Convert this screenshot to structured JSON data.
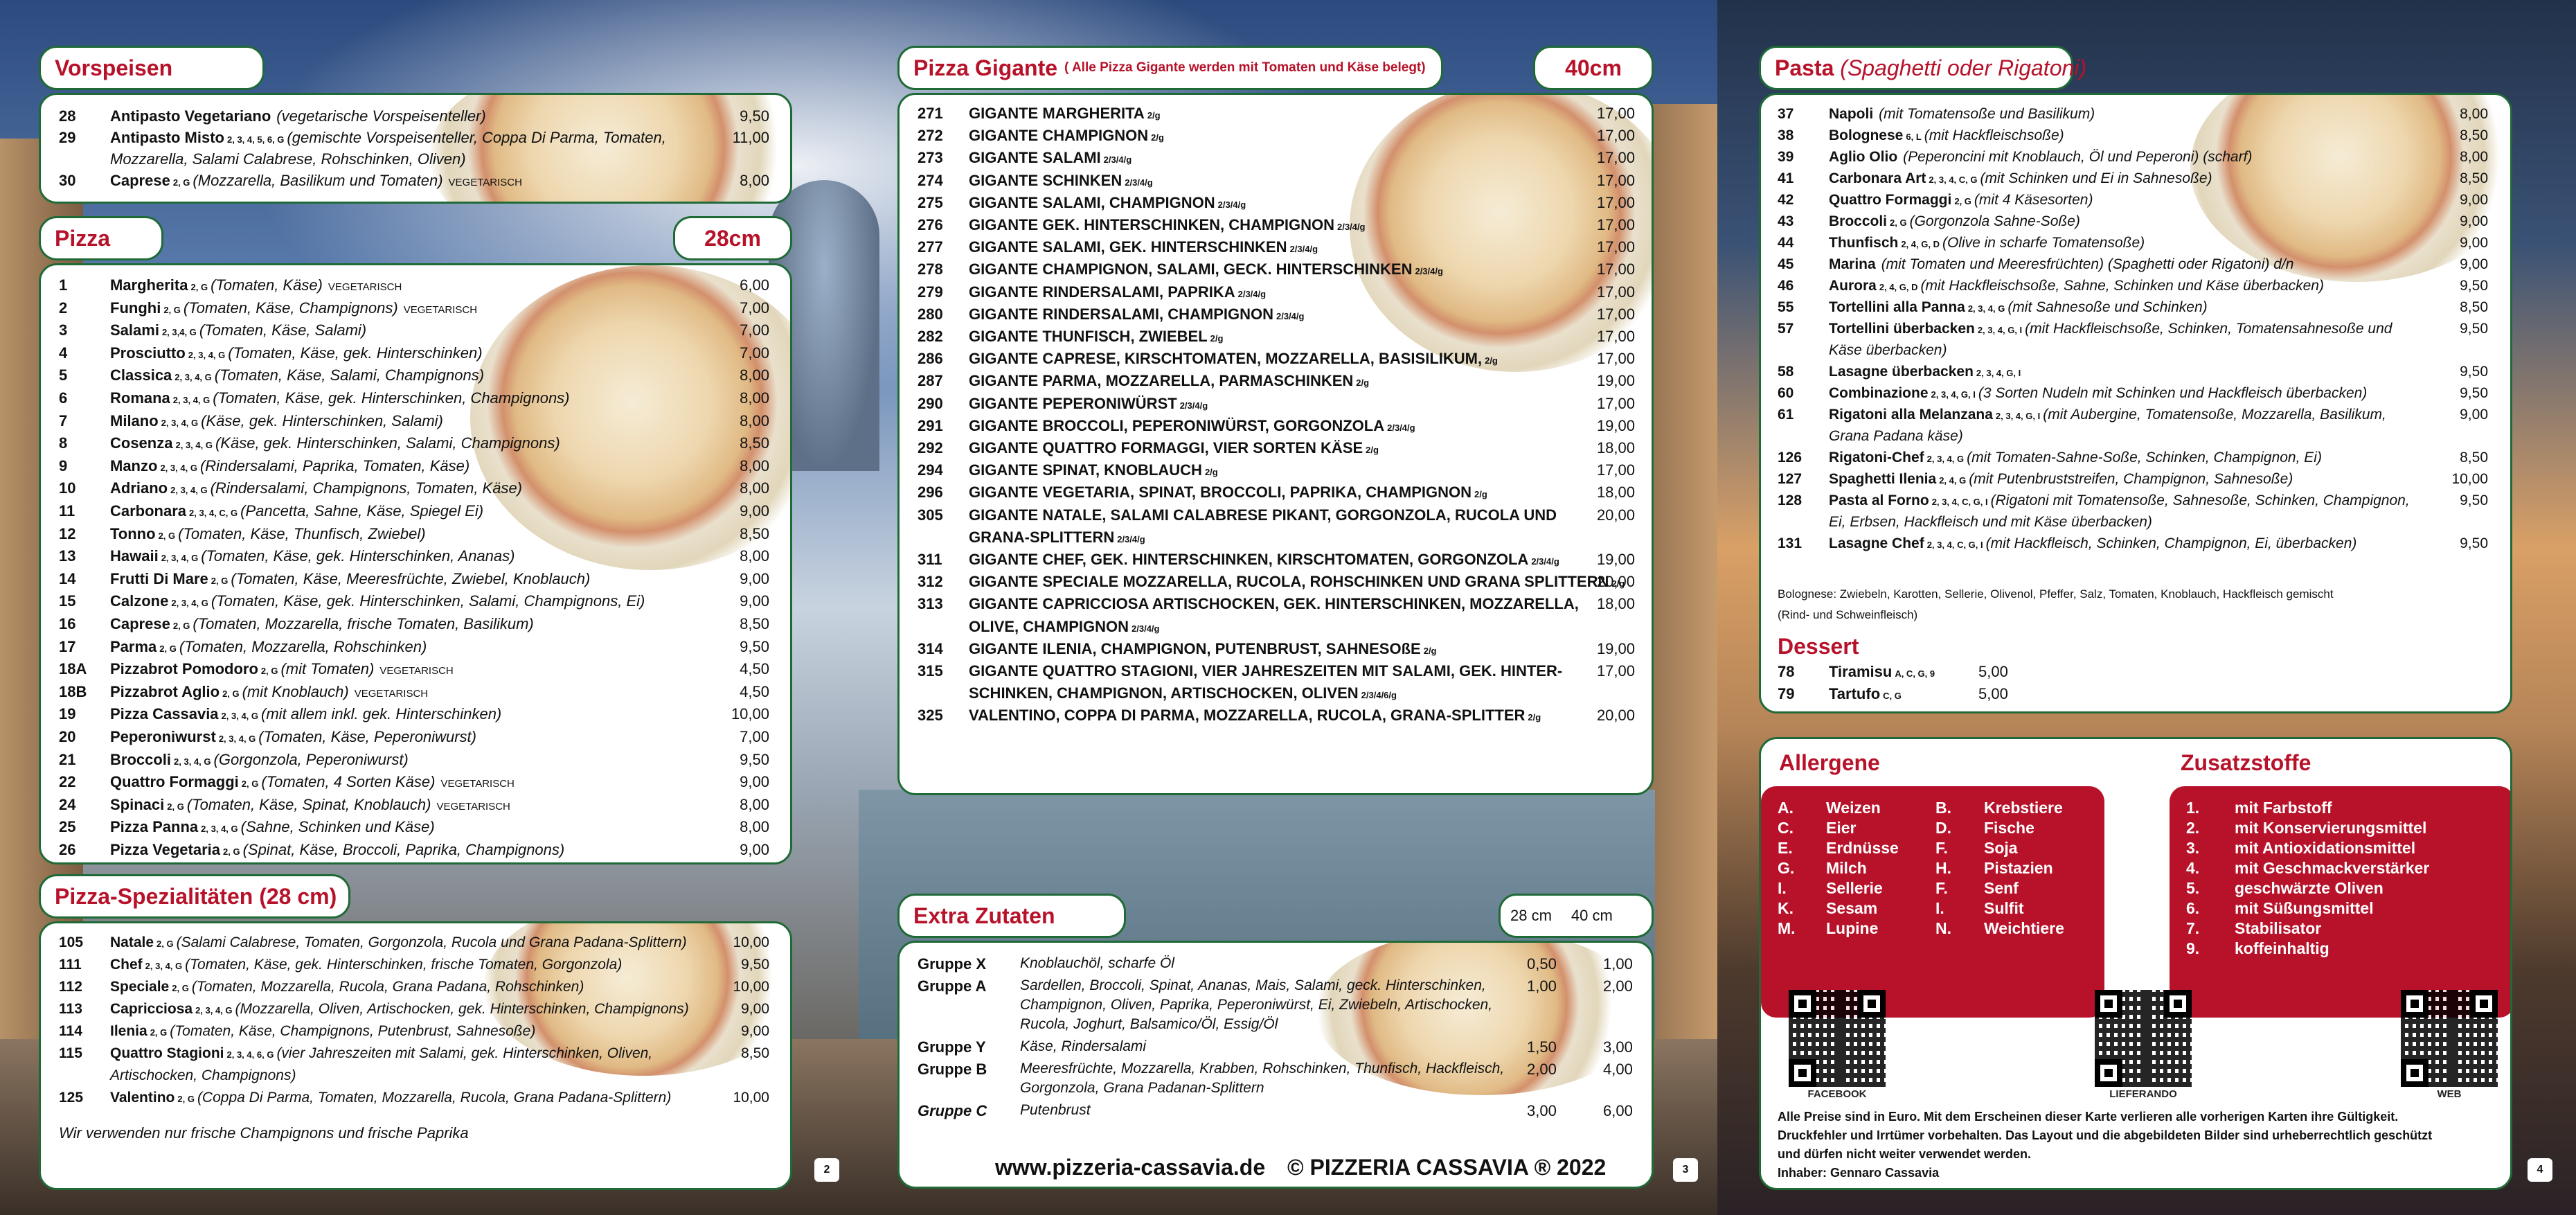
{
  "vorspeisen": {
    "title": "Vorspeisen",
    "items": [
      {
        "n": "28",
        "name": "Antipasto Vegetariano",
        "al": "",
        "desc": "(vegetarische Vorspeisenteller)",
        "price": "9,50"
      },
      {
        "n": "29",
        "name": "Antipasto Misto",
        "al": "2, 3, 4, 5, 6, G",
        "desc": "(gemischte Vorspeisenteller, Coppa Di Parma, Tomaten,",
        "price": "11,00",
        "cont": "Mozzarella, Salami Calabrese, Rohschinken, Oliven)"
      },
      {
        "n": "30",
        "name": "Caprese",
        "al": "2, G",
        "desc": "(Mozzarella, Basilikum und Tomaten)",
        "veg": "VEGETARISCH",
        "price": "8,00"
      }
    ]
  },
  "pizza": {
    "title": "Pizza",
    "size": "28cm",
    "items": [
      {
        "n": "1",
        "name": "Margherita",
        "al": "2, G",
        "desc": "(Tomaten, Käse)",
        "veg": "VEGETARISCH",
        "price": "6,00"
      },
      {
        "n": "2",
        "name": "Funghi",
        "al": "2, G",
        "desc": "(Tomaten, Käse, Champignons)",
        "veg": "VEGETARISCH",
        "price": "7,00"
      },
      {
        "n": "3",
        "name": "Salami",
        "al": "2, 3,4, G",
        "desc": "(Tomaten, Käse, Salami)",
        "price": "7,00"
      },
      {
        "n": "4",
        "name": "Prosciutto",
        "al": "2, 3, 4, G",
        "desc": "(Tomaten, Käse, gek. Hinterschinken)",
        "price": "7,00"
      },
      {
        "n": "5",
        "name": "Classica",
        "al": "2, 3, 4, G",
        "desc": "(Tomaten, Käse, Salami, Champignons)",
        "price": "8,00"
      },
      {
        "n": "6",
        "name": "Romana",
        "al": "2, 3, 4, G",
        "desc": "(Tomaten, Käse, gek. Hinterschinken, Champignons)",
        "price": "8,00"
      },
      {
        "n": "7",
        "name": "Milano",
        "al": "2, 3, 4, G",
        "desc": "(Käse, gek. Hinterschinken, Salami)",
        "price": "8,00"
      },
      {
        "n": "8",
        "name": "Cosenza",
        "al": "2, 3, 4, G",
        "desc": "(Käse, gek. Hinterschinken, Salami, Champignons)",
        "price": "8,50"
      },
      {
        "n": "9",
        "name": "Manzo",
        "al": "2, 3, 4, G",
        "desc": "(Rindersalami, Paprika, Tomaten, Käse)",
        "price": "8,00"
      },
      {
        "n": "10",
        "name": "Adriano",
        "al": "2, 3, 4, G",
        "desc": "(Rindersalami, Champignons, Tomaten, Käse)",
        "price": "8,00"
      },
      {
        "n": "11",
        "name": "Carbonara",
        "al": "2, 3, 4, C, G",
        "desc": "(Pancetta, Sahne, Käse, Spiegel Ei)",
        "price": "9,00"
      },
      {
        "n": "12",
        "name": "Tonno",
        "al": "2, G",
        "desc": "(Tomaten, Käse, Thunfisch, Zwiebel)",
        "price": "8,50"
      },
      {
        "n": "13",
        "name": "Hawaii",
        "al": "2, 3, 4, G",
        "desc": "(Tomaten, Käse, gek. Hinterschinken, Ananas)",
        "price": "8,00"
      },
      {
        "n": "14",
        "name": "Frutti Di Mare",
        "al": "2, G",
        "desc": "(Tomaten, Käse, Meeresfrüchte, Zwiebel, Knoblauch)",
        "price": "9,00"
      },
      {
        "n": "15",
        "name": "Calzone",
        "al": "2, 3, 4, G",
        "desc": "(Tomaten, Käse, gek. Hinterschinken, Salami, Champignons, Ei)",
        "price": "9,00"
      },
      {
        "n": "16",
        "name": "Caprese",
        "al": "2, G",
        "desc": "(Tomaten, Mozzarella, frische Tomaten, Basilikum)",
        "price": "8,50"
      },
      {
        "n": "17",
        "name": "Parma",
        "al": "2, G",
        "desc": "(Tomaten, Mozzarella, Rohschinken)",
        "price": "9,50"
      },
      {
        "n": "18A",
        "name": "Pizzabrot Pomodoro",
        "al": "2, G",
        "desc": "(mit Tomaten)",
        "veg": "VEGETARISCH",
        "price": "4,50"
      },
      {
        "n": "18B",
        "name": "Pizzabrot Aglio",
        "al": "2, G",
        "desc": "(mit Knoblauch)",
        "veg": "VEGETARISCH",
        "price": "4,50"
      },
      {
        "n": "19",
        "name": "Pizza Cassavia",
        "al": "2, 3, 4, G",
        "desc": "(mit allem inkl. gek. Hinterschinken)",
        "price": "10,00"
      },
      {
        "n": "20",
        "name": "Peperoniwurst",
        "al": "2, 3, 4, G",
        "desc": "(Tomaten, Käse, Peperoniwurst)",
        "price": "7,00"
      },
      {
        "n": "21",
        "name": "Broccoli",
        "al": "2, 3, 4, G",
        "desc": "(Gorgonzola, Peperoniwurst)",
        "price": "9,50"
      },
      {
        "n": "22",
        "name": "Quattro Formaggi",
        "al": "2, G",
        "desc": "(Tomaten, 4 Sorten Käse)",
        "veg": "VEGETARISCH",
        "price": "9,00"
      },
      {
        "n": "24",
        "name": "Spinaci",
        "al": "2, G",
        "desc": "(Tomaten, Käse, Spinat, Knoblauch)",
        "veg": "VEGETARISCH",
        "price": "8,00"
      },
      {
        "n": "25",
        "name": "Pizza Panna",
        "al": "2, 3, 4, G",
        "desc": "(Sahne, Schinken und Käse)",
        "price": "8,00"
      },
      {
        "n": "26",
        "name": "Pizza Vegetaria",
        "al": "2, G",
        "desc": "(Spinat, Käse, Broccoli, Paprika, Champignons)",
        "price": "9,00"
      }
    ]
  },
  "spezial": {
    "title": "Pizza-Spezialitäten (28 cm)",
    "items": [
      {
        "n": "105",
        "name": "Natale",
        "al": "2, G",
        "desc": "(Salami Calabrese, Tomaten, Gorgonzola, Rucola und Grana Padana-Splittern)",
        "price": "10,00"
      },
      {
        "n": "111",
        "name": "Chef",
        "al": "2, 3, 4, G",
        "desc": "(Tomaten, Käse, gek. Hinterschinken, frische Tomaten, Gorgonzola)",
        "price": "9,50"
      },
      {
        "n": "112",
        "name": "Speciale",
        "al": "2, G",
        "desc": "(Tomaten, Mozzarella, Rucola, Grana Padana, Rohschinken)",
        "price": "10,00"
      },
      {
        "n": "113",
        "name": "Capricciosa",
        "al": "2, 3, 4, G",
        "desc": "(Mozzarella, Oliven, Artischocken, gek. Hinterschinken, Champignons)",
        "price": "9,00"
      },
      {
        "n": "114",
        "name": "Ilenia",
        "al": "2, G",
        "desc": "(Tomaten, Käse, Champignons, Putenbrust, Sahnesoße)",
        "price": "9,00"
      },
      {
        "n": "115",
        "name": "Quattro Stagioni",
        "al": "2, 3, 4, 6, G",
        "desc": "(vier Jahreszeiten mit Salami, gek. Hinterschinken, Oliven,",
        "price": "8,50",
        "cont": "Artischocken, Champignons)"
      },
      {
        "n": "125",
        "name": "Valentino",
        "al": "2, G",
        "desc": "(Coppa Di Parma, Tomaten, Mozzarella, Rucola, Grana Padana-Splittern)",
        "price": "10,00"
      }
    ],
    "note": "Wir verwenden nur frische Champignons und frische Paprika"
  },
  "gigante": {
    "title": "Pizza Gigante",
    "sub": "( Alle Pizza Gigante werden mit Tomaten und Käse belegt)",
    "size": "40cm",
    "items": [
      {
        "n": "271",
        "name": "GIGANTE MARGHERITA",
        "al": "2/g",
        "price": "17,00"
      },
      {
        "n": "272",
        "name": "GIGANTE CHAMPIGNON",
        "al": "2/g",
        "price": "17,00"
      },
      {
        "n": "273",
        "name": "GIGANTE SALAMI",
        "al": "2/3/4/g",
        "price": "17,00"
      },
      {
        "n": "274",
        "name": "GIGANTE SCHINKEN",
        "al": "2/3/4/g",
        "price": "17,00"
      },
      {
        "n": "275",
        "name": "GIGANTE SALAMI, CHAMPIGNON",
        "al": "2/3/4/g",
        "price": "17,00"
      },
      {
        "n": "276",
        "name": "GIGANTE GEK. HINTERSCHINKEN, CHAMPIGNON",
        "al": "2/3/4/g",
        "price": "17,00"
      },
      {
        "n": "277",
        "name": "GIGANTE SALAMI, GEK. HINTERSCHINKEN",
        "al": "2/3/4/g",
        "price": "17,00"
      },
      {
        "n": "278",
        "name": "GIGANTE CHAMPIGNON, SALAMI, GECK. HINTERSCHINKEN",
        "al": "2/3/4/g",
        "price": "17,00"
      },
      {
        "n": "279",
        "name": "GIGANTE RINDERSALAMI, PAPRIKA",
        "al": "2/3/4/g",
        "price": "17,00"
      },
      {
        "n": "280",
        "name": "GIGANTE RINDERSALAMI, CHAMPIGNON",
        "al": "2/3/4/g",
        "price": "17,00"
      },
      {
        "n": "282",
        "name": "GIGANTE THUNFISCH, ZWIEBEL",
        "al": "2/g",
        "price": "17,00"
      },
      {
        "n": "286",
        "name": "GIGANTE CAPRESE, KIRSCHTOMATEN, MOZZARELLA, BASISILIKUM,",
        "al": "2/g",
        "price": "17,00"
      },
      {
        "n": "287",
        "name": "GIGANTE PARMA, MOZZARELLA, PARMASCHINKEN",
        "al": "2/g",
        "price": "19,00"
      },
      {
        "n": "290",
        "name": "GIGANTE PEPERONIWÜRST",
        "al": "2/3/4/g",
        "price": "17,00"
      },
      {
        "n": "291",
        "name": "GIGANTE BROCCOLI, PEPERONIWÜRST, GORGONZOLA",
        "al": "2/3/4/g",
        "price": "19,00"
      },
      {
        "n": "292",
        "name": "GIGANTE QUATTRO FORMAGGI, VIER SORTEN KÄSE",
        "al": "2/g",
        "price": "18,00"
      },
      {
        "n": "294",
        "name": "GIGANTE SPINAT, KNOBLAUCH",
        "al": "2/g",
        "price": "17,00"
      },
      {
        "n": "296",
        "name": "GIGANTE VEGETARIA, SPINAT, BROCCOLI, PAPRIKA, CHAMPIGNON",
        "al": "2/g",
        "price": "18,00"
      },
      {
        "n": "305",
        "name": "GIGANTE NATALE, SALAMI CALABRESE PIKANT, GORGONZOLA, RUCOLA UND",
        "al": "",
        "price": "20,00",
        "cont": "GRANA-SPLITTERN",
        "contal": "2/3/4/g"
      },
      {
        "n": "311",
        "name": "GIGANTE CHEF, GEK. HINTERSCHINKEN, KIRSCHTOMATEN, GORGONZOLA",
        "al": "2/3/4/g",
        "price": "19,00"
      },
      {
        "n": "312",
        "name": "GIGANTE SPECIALE MOZZARELLA, RUCOLA, ROHSCHINKEN UND GRANA SPLITTERN",
        "al": "2/g",
        "price": "20,00"
      },
      {
        "n": "313",
        "name": "GIGANTE CAPRICCIOSA ARTISCHOCKEN, GEK. HINTERSCHINKEN, MOZZARELLA,",
        "al": "",
        "price": "18,00",
        "cont": "OLIVE, CHAMPIGNON",
        "contal": "2/3/4/g"
      },
      {
        "n": "314",
        "name": "GIGANTE ILENIA, CHAMPIGNON, PUTENBRUST, SAHNESOßE",
        "al": "2/g",
        "price": "19,00"
      },
      {
        "n": "315",
        "name": "GIGANTE QUATTRO STAGIONI, VIER JAHRESZEITEN MIT SALAMI, GEK. HINTER-",
        "al": "",
        "price": "17,00",
        "cont": "SCHINKEN, CHAMPIGNON, ARTISCHOCKEN, OLIVEN",
        "contal": "2/3/4/6/g"
      },
      {
        "n": "325",
        "name": "VALENTINO, COPPA DI PARMA, MOZZARELLA, RUCOLA, GRANA-SPLITTER",
        "al": "2/g",
        "price": "20,00"
      }
    ]
  },
  "extra": {
    "title": "Extra Zutaten",
    "c1": "28 cm",
    "c2": "40 cm",
    "groups": [
      {
        "g": "Gruppe X",
        "lines": [
          "Knoblauchöl, scharfe Öl"
        ],
        "p1": "0,50",
        "p2": "1,00"
      },
      {
        "g": "Gruppe A",
        "lines": [
          "Sardellen, Broccoli, Spinat, Ananas, Mais, Salami, geck. Hinterschinken,",
          "Champignon, Oliven, Paprika, Peperoniwürst, Ei, Zwiebeln, Artischocken,",
          "Rucola, Joghurt, Balsamico/Öl, Essig/Öl"
        ],
        "p1": "1,00",
        "p2": "2,00"
      },
      {
        "g": "Gruppe Y",
        "lines": [
          "Käse, Rindersalami"
        ],
        "p1": "1,50",
        "p2": "3,00"
      },
      {
        "g": "Gruppe B",
        "lines": [
          "Meeresfrüchte, Mozzarella, Krabben, Rohschinken, Thunfisch, Hackfleisch,",
          "Gorgonzola, Grana Padanan-Splittern"
        ],
        "p1": "2,00",
        "p2": "4,00"
      },
      {
        "g": "Gruppe C",
        "lines": [
          "Putenbrust"
        ],
        "p1": "3,00",
        "p2": "6,00",
        "italic": true
      }
    ]
  },
  "footer": {
    "web": "www.pizzeria-cassavia.de",
    "copy": "© PIZZERIA CASSAVIA ® 2022",
    "p2": "2",
    "p3": "3",
    "p4": "4"
  },
  "pasta": {
    "title": "Pasta",
    "sub": "(Spaghetti oder Rigatoni)",
    "items": [
      {
        "n": "37",
        "name": "Napoli",
        "al": "",
        "desc": "(mit Tomatensoße und Basilikum)",
        "price": "8,00"
      },
      {
        "n": "38",
        "name": "Bolognese",
        "al": "6, L",
        "desc": "(mit Hackfleischsoße)",
        "price": "8,50"
      },
      {
        "n": "39",
        "name": "Aglio Olio",
        "al": "",
        "desc": "(Peperoncini mit Knoblauch, Öl und Peperoni) (scharf)",
        "price": "8,00"
      },
      {
        "n": "41",
        "name": "Carbonara Art",
        "al": "2, 3, 4, C, G",
        "desc": "(mit Schinken und Ei in Sahnesoße)",
        "price": "8,50"
      },
      {
        "n": "42",
        "name": "Quattro Formaggi",
        "al": "2, G",
        "desc": "(mit 4 Käsesorten)",
        "price": "9,00"
      },
      {
        "n": "43",
        "name": "Broccoli",
        "al": "2, G",
        "desc": "(Gorgonzola Sahne-Soße)",
        "price": "9,00"
      },
      {
        "n": "44",
        "name": "Thunfisch",
        "al": "2, 4, G, D",
        "desc": "(Olive in scharfe Tomatensoße)",
        "price": "9,00"
      },
      {
        "n": "45",
        "name": "Marina",
        "al": "",
        "desc": "(mit Tomaten und Meeresfrüchten) (Spaghetti oder Rigatoni) d/n",
        "price": "9,00"
      },
      {
        "n": "46",
        "name": "Aurora",
        "al": "2, 4, G, D",
        "desc": "(mit Hackfleischsoße, Sahne, Schinken und Käse überbacken)",
        "price": "9,50"
      },
      {
        "n": "55",
        "name": " Tortellini alla Panna",
        "al": "2, 3, 4, G",
        "desc": "(mit Sahnesoße und Schinken)",
        "price": "8,50"
      },
      {
        "n": "57",
        "name": "Tortellini überbacken",
        "al": "2, 3, 4, G, I",
        "desc": "(mit Hackfleischsoße, Schinken, Tomatensahnesoße und",
        "price": "9,50",
        "cont": "Käse überbacken)"
      },
      {
        "n": "58",
        "name": "Lasagne überbacken",
        "al": "2, 3, 4, G, I",
        "desc": "",
        "price": "9,50"
      },
      {
        "n": "60",
        "name": "Combinazione",
        "al": "2, 3, 4, G, I",
        "desc": "(3 Sorten Nudeln mit Schinken und Hackfleisch überbacken)",
        "price": "9,50"
      },
      {
        "n": "61",
        "name": "Rigatoni alla Melanzana",
        "al": "2, 3, 4, G, I",
        "desc": "(mit Aubergine, Tomatensoße, Mozzarella, Basilikum,",
        "price": "9,00",
        "cont": "Grana Padana käse)"
      },
      {
        "n": "126",
        "name": "Rigatoni-Chef",
        "al": "2, 3, 4, G",
        "desc": "(mit Tomaten-Sahne-Soße, Schinken, Champignon, Ei)",
        "price": "8,50"
      },
      {
        "n": "127",
        "name": "Spaghetti Ilenia",
        "al": "2, 4, G",
        "desc": "(mit Putenbruststreifen, Champignon, Sahnesoße)",
        "price": "10,00"
      },
      {
        "n": "128",
        "name": "Pasta al Forno",
        "al": "2, 3, 4, C, G, I",
        "desc": "(Rigatoni mit Tomatensoße, Sahnesoße, Schinken, Champignon,",
        "price": "9,50",
        "cont": "Ei, Erbsen, Hackfleisch und mit Käse überbacken)"
      },
      {
        "n": "131",
        "name": "Lasagne Chef",
        "al": "2, 3, 4, C, G, I",
        "desc": "(mit Hackfleisch, Schinken, Champignon, Ei, überbacken)",
        "price": "9,50"
      }
    ],
    "bolognese1": "Bolognese: Zwiebeln, Karotten, Sellerie, Olivenol, Pfeffer, Salz, Tomaten, Knoblauch, Hackfleisch gemischt",
    "bolognese2": "(Rind- und Schweinfleisch)"
  },
  "dessert": {
    "title": "Dessert",
    "items": [
      {
        "n": "78",
        "name": "Tiramisu",
        "al": "A, C, G, 9",
        "price": "5,00"
      },
      {
        "n": "79",
        "name": "Tartufo",
        "al": "C, G",
        "price": "5,00"
      }
    ]
  },
  "allergene": {
    "title": "Allergene",
    "col1": [
      [
        "A.",
        "Weizen"
      ],
      [
        "C.",
        "Eier"
      ],
      [
        "E.",
        "Erdnüsse"
      ],
      [
        "G.",
        "Milch"
      ],
      [
        "I.",
        "Sellerie"
      ],
      [
        "K.",
        "Sesam"
      ],
      [
        "M.",
        "Lupine"
      ]
    ],
    "col2": [
      [
        "B.",
        "Krebstiere"
      ],
      [
        "D.",
        "Fische"
      ],
      [
        "F.",
        "Soja"
      ],
      [
        "H.",
        "Pistazien"
      ],
      [
        "F.",
        "Senf"
      ],
      [
        "I.",
        "Sulfit"
      ],
      [
        "N.",
        "Weichtiere"
      ]
    ]
  },
  "zusatz": {
    "title": "Zusatzstoffe",
    "items": [
      [
        "1.",
        "mit Farbstoff"
      ],
      [
        "2.",
        "mit Konservierungsmittel"
      ],
      [
        "3.",
        "mit Antioxidationsmittel"
      ],
      [
        "4.",
        "mit Geschmackverstärker"
      ],
      [
        "5.",
        "geschwärzte Oliven"
      ],
      [
        "6.",
        "mit Süßungsmittel"
      ],
      [
        "7.",
        "Stabilisator"
      ],
      [
        "9.",
        "koffeinhaltig"
      ]
    ]
  },
  "qr": {
    "l1": "FACEBOOK",
    "l2": "LIEFERANDO",
    "l3": "WEB"
  },
  "legal": [
    "Alle Preise sind in Euro.  Mit dem Erscheinen dieser Karte verlieren alle vorherigen Karten ihre Gültigkeit.",
    "Druckfehler und Irrtümer vorbehalten. Das Layout und die abgebildeten Bilder sind urheberrechtlich geschützt",
    "und dürfen nicht weiter verwendet werden.",
    "Inhaber: Gennaro Cassavia"
  ]
}
